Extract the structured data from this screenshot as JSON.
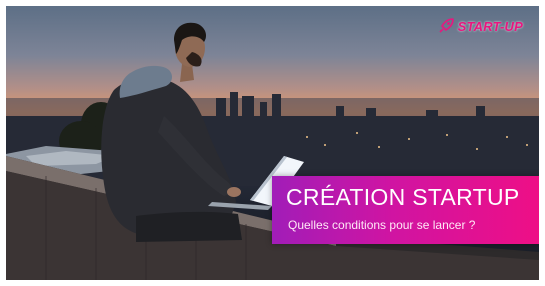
{
  "logo": {
    "text": "START-UP"
  },
  "banner": {
    "title": "CRÉATION STARTUP",
    "subtitle": "Quelles conditions pour se lancer ?"
  },
  "colors": {
    "accent_magenta": "#e8177f",
    "banner_start": "#a11db8",
    "banner_end": "#ee0f86",
    "sunset_orange": "#e29a6c",
    "laptop_screen": "#f2f6fb"
  },
  "icons": {
    "logo_mark": "rocket-icon"
  }
}
